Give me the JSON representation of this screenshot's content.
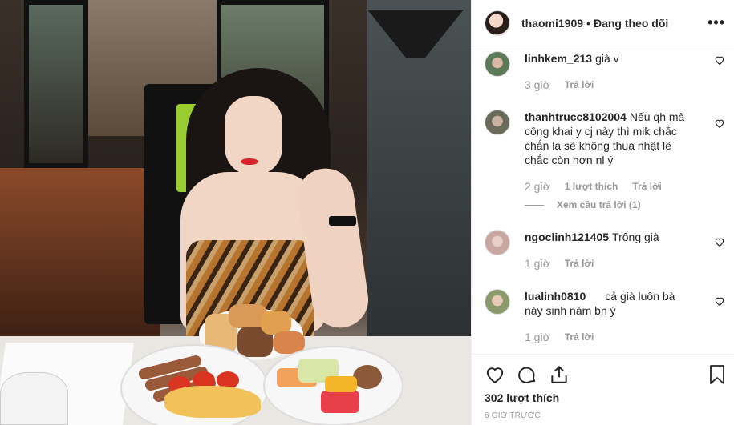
{
  "post": {
    "username": "thaomi1909",
    "separator": "•",
    "follow_state": "Đang theo dõi",
    "more": "•••"
  },
  "comments": [
    {
      "username": "linhkem_213",
      "text": "già v",
      "age": "3 giờ",
      "reply": "Trả lời"
    },
    {
      "username": "thanhtrucc8102004",
      "text": "Nếu qh mà công khai y cj này thì mik chắc chắn là sẽ không thua nhật lê chắc còn hơn nl ý",
      "age": "2 giờ",
      "likes": "1 lượt thích",
      "reply": "Trả lời",
      "view_replies": "Xem câu trả lời (1)"
    },
    {
      "username": "ngoclinh121405",
      "text": "Trông già",
      "age": "1 giờ",
      "reply": "Trả lời"
    },
    {
      "username": "lualinh0810",
      "text": "cả già luôn bà này sinh năm bn ý",
      "age": "1 giờ",
      "reply": "Trả lời"
    }
  ],
  "actions": {
    "like_icon": "heart-icon",
    "comment_icon": "comment-icon",
    "share_icon": "share-icon",
    "save_icon": "bookmark-icon",
    "likes_count": "302 lượt thích",
    "time_ago": "6 GIỜ TRƯỚC"
  },
  "colors": {
    "text": "#262626",
    "muted": "#999999",
    "border": "#efefef"
  }
}
